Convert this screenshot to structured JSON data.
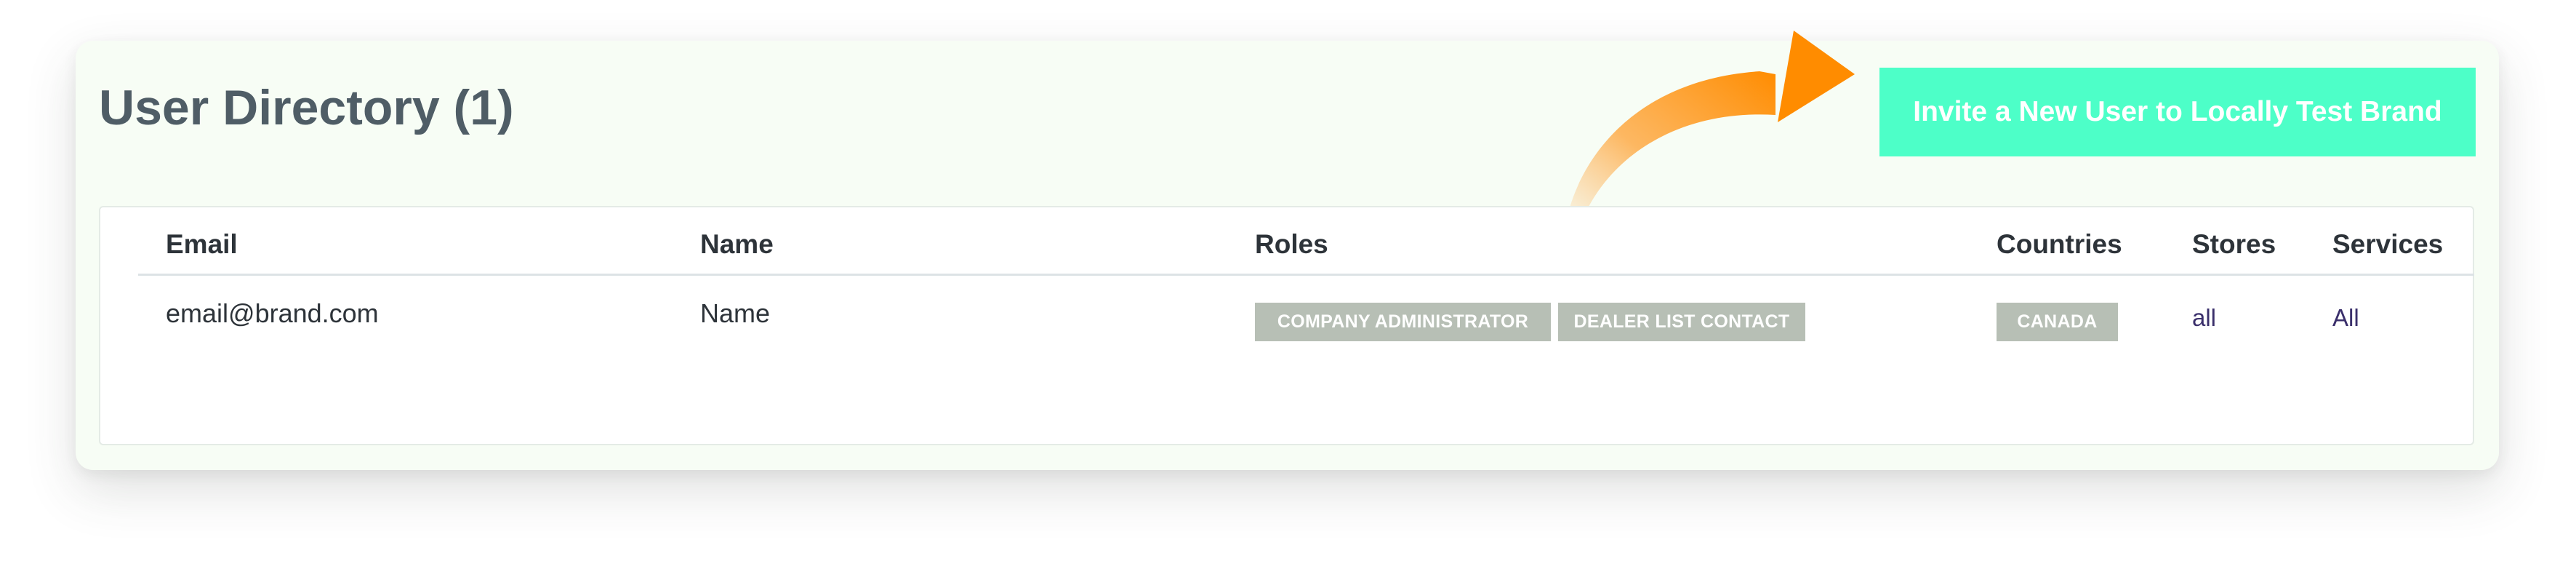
{
  "page": {
    "title": "User Directory (1)"
  },
  "actions": {
    "invite_label": "Invite a New User to Locally Test Brand"
  },
  "table": {
    "columns": [
      "Email",
      "Name",
      "Roles",
      "Countries",
      "Stores",
      "Services"
    ],
    "rows": [
      {
        "email": "email@brand.com",
        "name": "Name",
        "roles": [
          "COMPANY ADMINISTRATOR",
          "DEALER LIST CONTACT"
        ],
        "countries": [
          "CANADA"
        ],
        "stores": "all",
        "services": "All"
      }
    ]
  },
  "icons": {
    "callout": "curved-arrow-icon"
  },
  "colors": {
    "accent_button": "#4dffc8",
    "arrow": "#ff8c00",
    "badge": "#b7bfb5",
    "title": "#4f5d66",
    "card_background": "#f7fdf5"
  }
}
